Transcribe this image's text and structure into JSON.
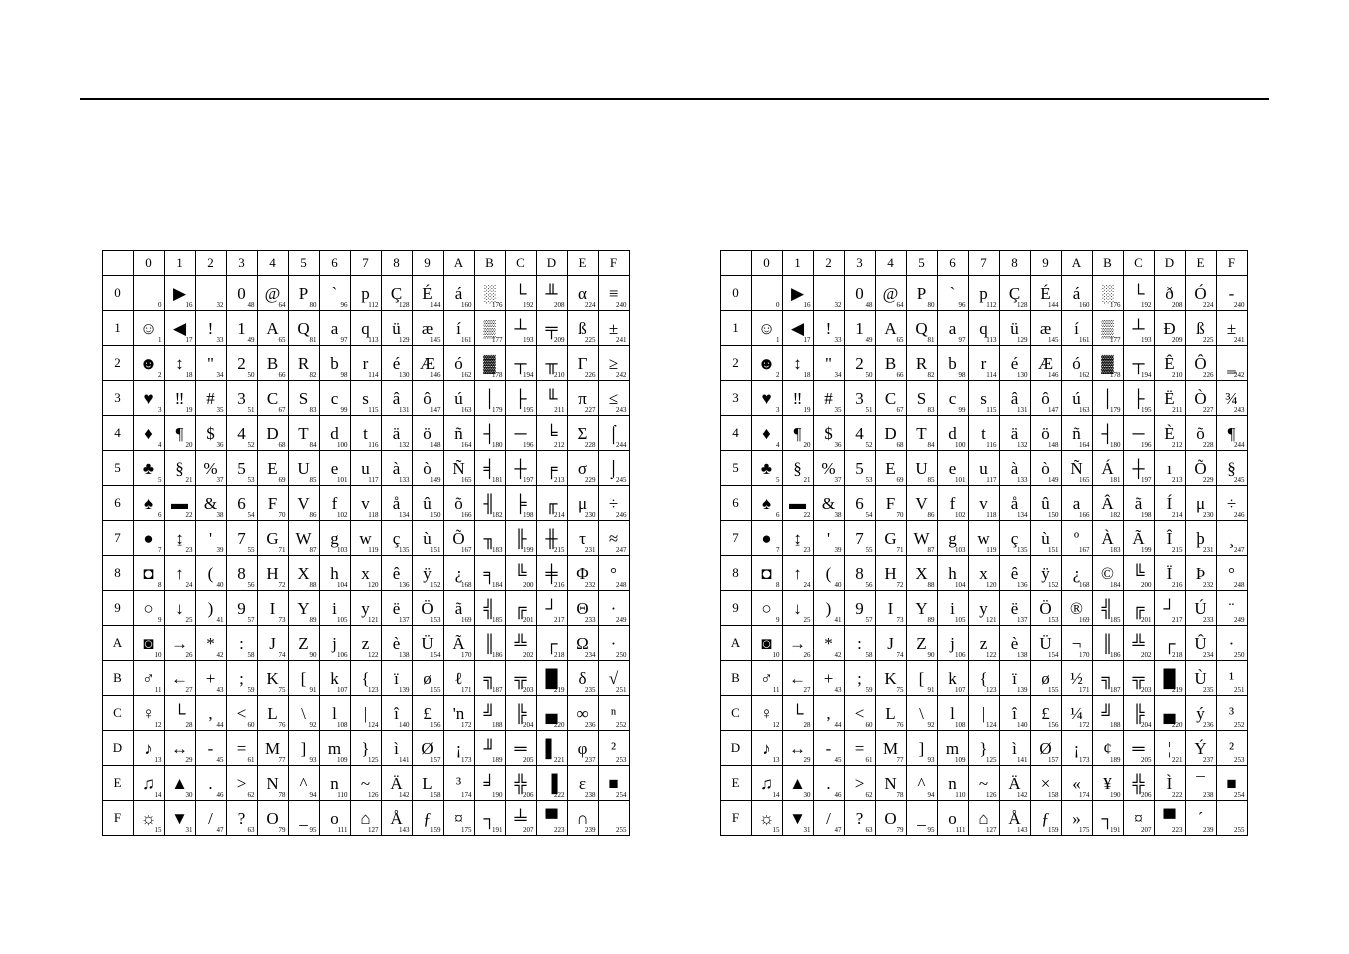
{
  "hexCols": [
    "0",
    "1",
    "2",
    "3",
    "4",
    "5",
    "6",
    "7",
    "8",
    "9",
    "A",
    "B",
    "C",
    "D",
    "E",
    "F"
  ],
  "hexRows": [
    "0",
    "1",
    "2",
    "3",
    "4",
    "5",
    "6",
    "7",
    "8",
    "9",
    "A",
    "B",
    "C",
    "D",
    "E",
    "F"
  ],
  "tableA": {
    "glyphs": [
      [
        "",
        "▶",
        "",
        "0",
        "@",
        "P",
        "`",
        "p",
        "Ç",
        "É",
        "á",
        "░",
        "└",
        "╨",
        "α",
        "≡"
      ],
      [
        "☺",
        "◀",
        "!",
        "1",
        "A",
        "Q",
        "a",
        "q",
        "ü",
        "æ",
        "í",
        "▒",
        "┴",
        "╤",
        "ß",
        "±"
      ],
      [
        "☻",
        "↕",
        "\"",
        "2",
        "B",
        "R",
        "b",
        "r",
        "é",
        "Æ",
        "ó",
        "▓",
        "┬",
        "╥",
        "Γ",
        "≥"
      ],
      [
        "♥",
        "‼",
        "#",
        "3",
        "C",
        "S",
        "c",
        "s",
        "â",
        "ô",
        "ú",
        "│",
        "├",
        "╙",
        "π",
        "≤"
      ],
      [
        "♦",
        "¶",
        "$",
        "4",
        "D",
        "T",
        "d",
        "t",
        "ä",
        "ö",
        "ñ",
        "┤",
        "─",
        "╘",
        "Σ",
        "⌠"
      ],
      [
        "♣",
        "§",
        "%",
        "5",
        "E",
        "U",
        "e",
        "u",
        "à",
        "ò",
        "Ñ",
        "╡",
        "┼",
        "╒",
        "σ",
        "⌡"
      ],
      [
        "♠",
        "▬",
        "&",
        "6",
        "F",
        "V",
        "f",
        "v",
        "å",
        "û",
        "õ",
        "╢",
        "╞",
        "╓",
        "μ",
        "÷"
      ],
      [
        "●",
        "↨",
        "'",
        "7",
        "G",
        "W",
        "g",
        "w",
        "ç",
        "ù",
        "Õ",
        "╖",
        "╟",
        "╫",
        "τ",
        "≈"
      ],
      [
        "◘",
        "↑",
        "(",
        "8",
        "H",
        "X",
        "h",
        "x",
        "ê",
        "ÿ",
        "¿",
        "╕",
        "╚",
        "╪",
        "Φ",
        "°"
      ],
      [
        "○",
        "↓",
        ")",
        "9",
        "I",
        "Y",
        "i",
        "y",
        "ë",
        "Ö",
        "ã",
        "╣",
        "╔",
        "┘",
        "Θ",
        "·"
      ],
      [
        "◙",
        "→",
        "*",
        ":",
        "J",
        "Z",
        "j",
        "z",
        "è",
        "Ü",
        "Ã",
        "║",
        "╩",
        "┌",
        "Ω",
        "·"
      ],
      [
        "♂",
        "←",
        "+",
        ";",
        "K",
        "[",
        "k",
        "{",
        "ï",
        "ø",
        "ℓ",
        "╗",
        "╦",
        "█",
        "δ",
        "√"
      ],
      [
        "♀",
        "└",
        ",",
        "<",
        "L",
        "\\",
        "l",
        "|",
        "î",
        "£",
        "'n",
        "╝",
        "╠",
        "▄",
        "∞",
        "ⁿ"
      ],
      [
        "♪",
        "↔",
        "-",
        "=",
        "M",
        "]",
        "m",
        "}",
        "ì",
        "Ø",
        "¡",
        "╜",
        "═",
        "▌",
        "φ",
        "²"
      ],
      [
        "♫",
        "▲",
        ".",
        ">",
        "N",
        "^",
        "n",
        "~",
        "Ä",
        "L",
        "³",
        "╛",
        "╬",
        "▐",
        "ε",
        "■"
      ],
      [
        "☼",
        "▼",
        "/",
        "?",
        "O",
        "_",
        "o",
        "⌂",
        "Å",
        "ƒ",
        "¤",
        "┐",
        "╧",
        "▀",
        "∩",
        ""
      ]
    ]
  },
  "tableB": {
    "glyphs": [
      [
        "",
        "▶",
        "",
        "0",
        "@",
        "P",
        "`",
        "p",
        "Ç",
        "É",
        "á",
        "░",
        "└",
        "ð",
        "Ó",
        "-"
      ],
      [
        "☺",
        "◀",
        "!",
        "1",
        "A",
        "Q",
        "a",
        "q",
        "ü",
        "æ",
        "í",
        "▒",
        "┴",
        "Ð",
        "ß",
        "±"
      ],
      [
        "☻",
        "↕",
        "\"",
        "2",
        "B",
        "R",
        "b",
        "r",
        "é",
        "Æ",
        "ó",
        "▓",
        "┬",
        "Ê",
        "Ô",
        "‗"
      ],
      [
        "♥",
        "‼",
        "#",
        "3",
        "C",
        "S",
        "c",
        "s",
        "â",
        "ô",
        "ú",
        "│",
        "├",
        "Ë",
        "Ò",
        "¾"
      ],
      [
        "♦",
        "¶",
        "$",
        "4",
        "D",
        "T",
        "d",
        "t",
        "ä",
        "ö",
        "ñ",
        "┤",
        "─",
        "È",
        "õ",
        "¶"
      ],
      [
        "♣",
        "§",
        "%",
        "5",
        "E",
        "U",
        "e",
        "u",
        "à",
        "ò",
        "Ñ",
        "Á",
        "┼",
        "ı",
        "Õ",
        "§"
      ],
      [
        "♠",
        "▬",
        "&",
        "6",
        "F",
        "V",
        "f",
        "v",
        "å",
        "û",
        "a",
        "Â",
        "ã",
        "Í",
        "μ",
        "÷"
      ],
      [
        "●",
        "↨",
        "'",
        "7",
        "G",
        "W",
        "g",
        "w",
        "ç",
        "ù",
        "º",
        "À",
        "Ã",
        "Î",
        "þ",
        "¸"
      ],
      [
        "◘",
        "↑",
        "(",
        "8",
        "H",
        "X",
        "h",
        "x",
        "ê",
        "ÿ",
        "¿",
        "©",
        "╚",
        "Ï",
        "Þ",
        "°"
      ],
      [
        "○",
        "↓",
        ")",
        "9",
        "I",
        "Y",
        "i",
        "y",
        "ë",
        "Ö",
        "®",
        "╣",
        "╔",
        "┘",
        "Ú",
        "¨"
      ],
      [
        "◙",
        "→",
        "*",
        ":",
        "J",
        "Z",
        "j",
        "z",
        "è",
        "Ü",
        "¬",
        "║",
        "╩",
        "┌",
        "Û",
        "·"
      ],
      [
        "♂",
        "←",
        "+",
        ";",
        "K",
        "[",
        "k",
        "{",
        "ï",
        "ø",
        "½",
        "╗",
        "╦",
        "█",
        "Ù",
        "¹"
      ],
      [
        "♀",
        "└",
        ",",
        "<",
        "L",
        "\\",
        "l",
        "|",
        "î",
        "£",
        "¼",
        "╝",
        "╠",
        "▄",
        "ý",
        "³"
      ],
      [
        "♪",
        "↔",
        "-",
        "=",
        "M",
        "]",
        "m",
        "}",
        "ì",
        "Ø",
        "¡",
        "¢",
        "═",
        "¦",
        "Ý",
        "²"
      ],
      [
        "♫",
        "▲",
        ".",
        ">",
        "N",
        "^",
        "n",
        "~",
        "Ä",
        "×",
        "«",
        "¥",
        "╬",
        "Ì",
        "¯",
        "■"
      ],
      [
        "☼",
        "▼",
        "/",
        "?",
        "O",
        "_",
        "o",
        "⌂",
        "Å",
        "ƒ",
        "»",
        "┐",
        "¤",
        "▀",
        "´",
        ""
      ]
    ]
  }
}
